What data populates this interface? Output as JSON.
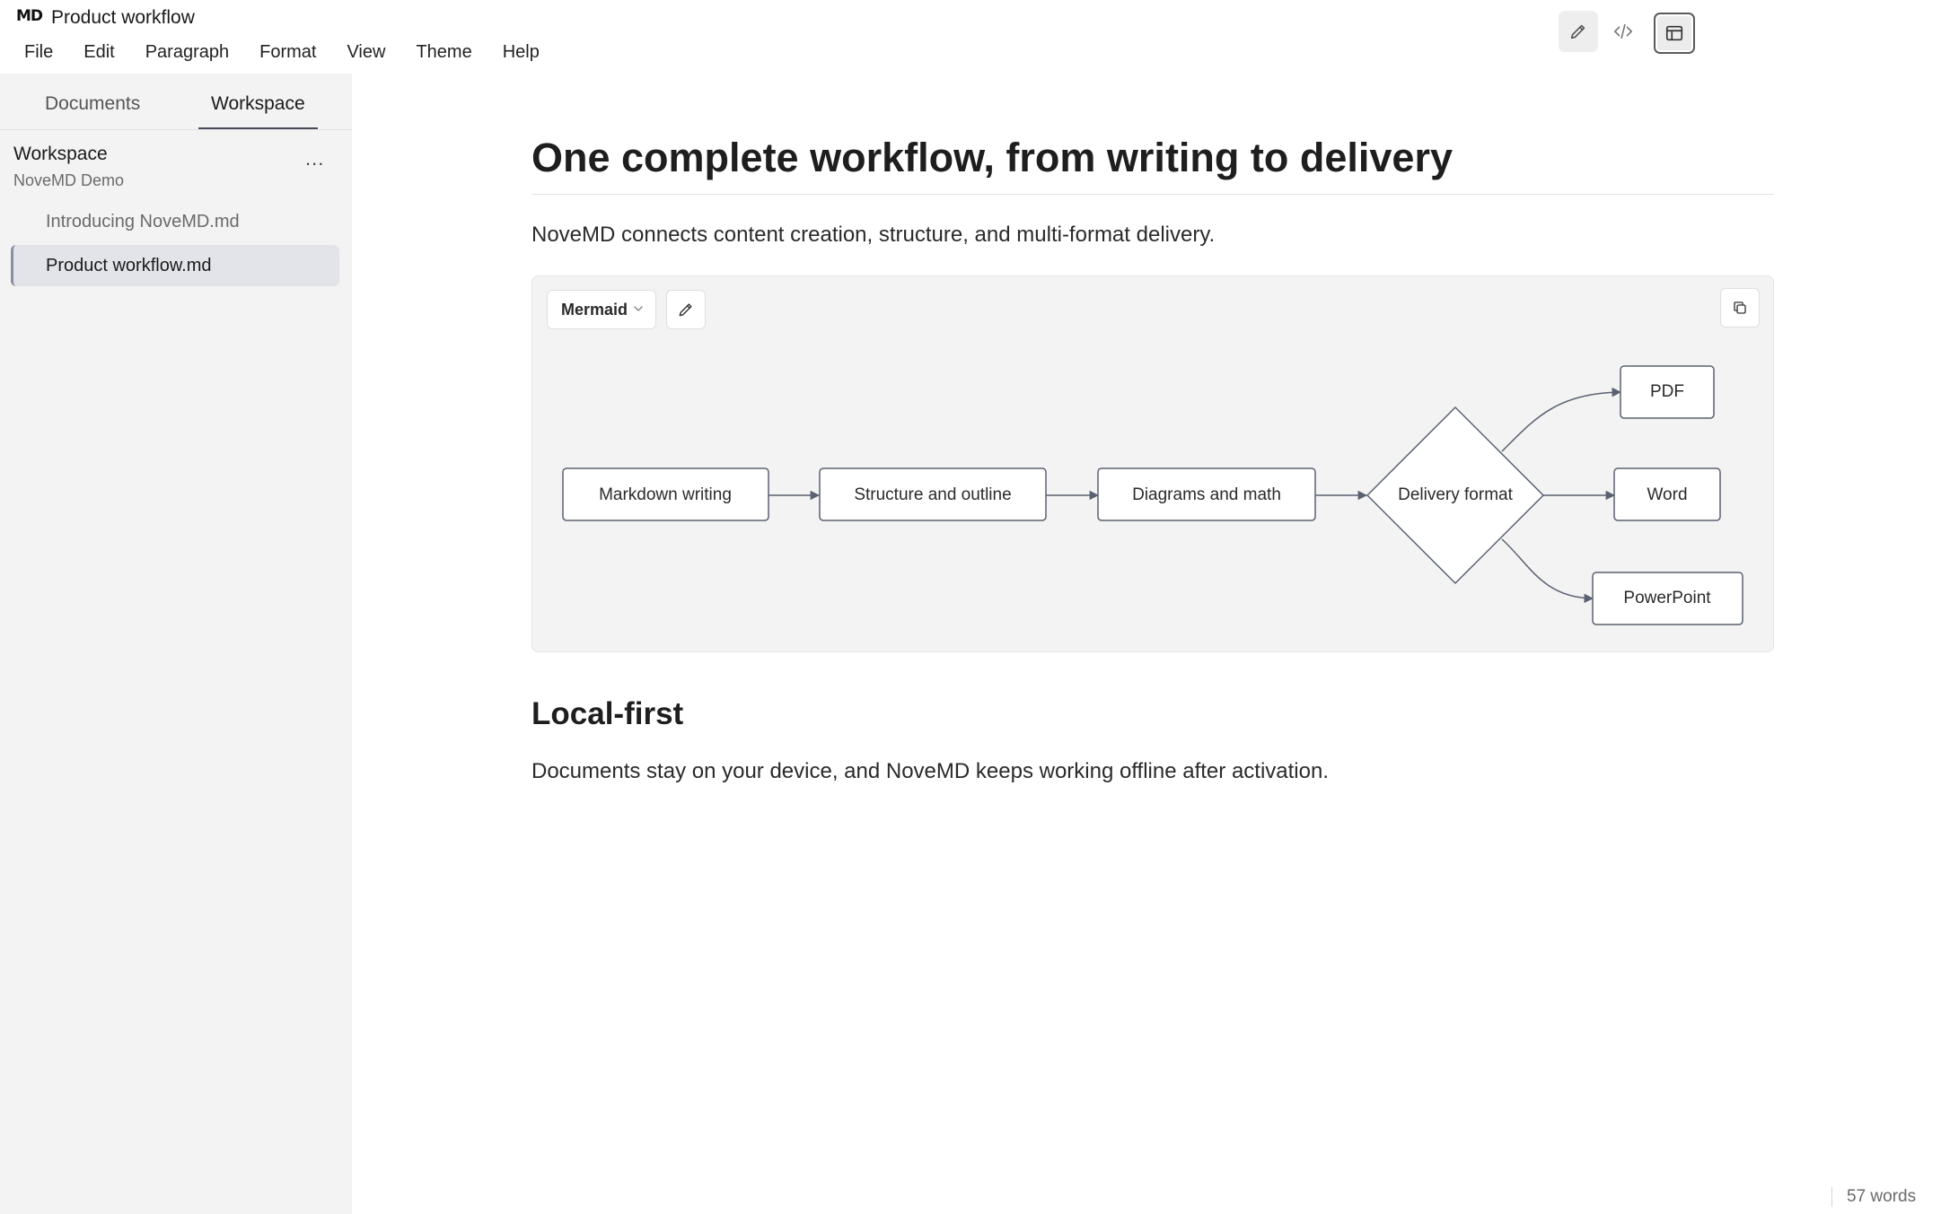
{
  "app": {
    "logo_text": "MD",
    "window_title": "Product workflow"
  },
  "view_toggles": [
    {
      "name": "edit-mode",
      "icon": "pencil-icon",
      "active": false
    },
    {
      "name": "source-mode",
      "icon": "code-icon",
      "active": false
    },
    {
      "name": "preview-mode",
      "icon": "layout-icon",
      "active": true
    }
  ],
  "menu": [
    "File",
    "Edit",
    "Paragraph",
    "Format",
    "View",
    "Theme",
    "Help"
  ],
  "sidebar": {
    "tabs": [
      {
        "label": "Documents",
        "active": false
      },
      {
        "label": "Workspace",
        "active": true
      }
    ],
    "workspace_title": "Workspace",
    "workspace_name": "NoveMD Demo",
    "more_label": "...",
    "files": [
      {
        "label": "Introducing NoveMD.md",
        "selected": false
      },
      {
        "label": "Product workflow.md",
        "selected": true
      }
    ]
  },
  "document": {
    "heading": "One complete workflow, from writing to delivery",
    "intro": "NoveMD connects content creation, structure, and multi-format delivery.",
    "code_block": {
      "language": "Mermaid",
      "edit_icon": "pencil-icon",
      "copy_icon": "copy-icon",
      "diagram": {
        "nodes": {
          "markdown": "Markdown writing",
          "structure": "Structure and outline",
          "diagrams": "Diagrams and math",
          "decision": "Delivery format",
          "pdf": "PDF",
          "word": "Word",
          "ppt": "PowerPoint"
        }
      }
    },
    "section_heading": "Local-first",
    "section_text": "Documents stay on your device, and NoveMD keeps working offline after activation."
  },
  "status": {
    "word_count": "57 words"
  },
  "colors": {
    "sidebar_bg": "#f3f3f3",
    "selected_file_bg": "#e3e4e9",
    "diagram_stroke": "#5a6170",
    "block_bg": "#f3f3f3"
  }
}
